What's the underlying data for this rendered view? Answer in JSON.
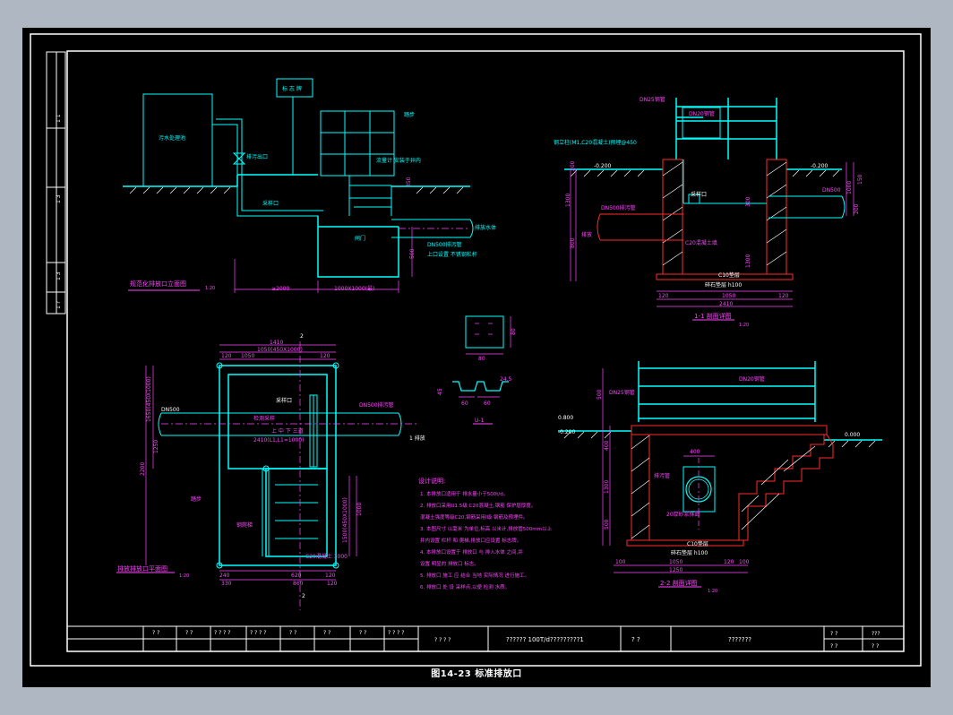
{
  "colors": {
    "background": "#000000",
    "frame": "#ffffff",
    "outline": "#00ffff",
    "dimension": "#ff44ff",
    "section": "#ff2a2a",
    "hatch": "#ffffff",
    "outer": "#aeb7c2"
  },
  "caption": "图14-23 标准排放口",
  "sidebar": {
    "labels": [
      "1 1",
      "1 3",
      "1 3",
      "1 ?"
    ]
  },
  "elevation_view": {
    "title": "规范化排放口立面图",
    "scale": "1:20",
    "sign_label": "标 志 牌",
    "outlet_label": "排污出口",
    "facility_label": "污水处理池",
    "sampling_label": "采样口",
    "ladder_label": "踏步",
    "valve_label": "闸门",
    "pipe_label": "DN500排污管",
    "pipe_dir": "排放水体",
    "min_depth": "≥2000",
    "well_size": "1000X1000(最)",
    "dim_500": "500",
    "dim_350": "350",
    "flow_note": "流量计 安装于井内",
    "wall_note": "上口设置 不锈钢栏杆"
  },
  "section_1_1": {
    "title": "1-1 剖面详图",
    "scale": "1:20",
    "elev_left": "-0.200",
    "elev_right": "-0.200",
    "rail_label": "DN25钢管",
    "rail_label2": "DN20钢管",
    "top_note": "钢立柱(M1,C20混凝土)预埋@450",
    "pipe_label": "DN500排污管",
    "pipe_label_right": "DN500",
    "hole_label": "C20混凝土填",
    "sample_label": "采样口",
    "base_label": "C10垫层",
    "base_detail": "碎石垫层 h100",
    "dims_bottom": [
      "120",
      "1050",
      "120",
      "2410"
    ],
    "dims_left": [
      "200",
      "800",
      "1300"
    ],
    "dims_right": [
      "300",
      "1300",
      "1000",
      "200",
      "150"
    ],
    "water_label": "排放"
  },
  "plan_view": {
    "title": "排放排放口平面图",
    "scale": "1:20",
    "pipe_label": "DN500",
    "pipe_right_label": "DN500排污管",
    "dir_label": "1 排放",
    "sample_label": "采样口",
    "inlet_label": "检测采样",
    "ladder_label": "钢爬梯",
    "stair_label": "踏步",
    "elev_label": "C20混凝土 3000",
    "rail_note": "上 中 下 三道",
    "rail_spec": "2410(L1,L1=1000)",
    "dims_top": [
      "1410",
      "120",
      "1050",
      "120",
      "1050(450X1000)"
    ],
    "dims_bottom": [
      "240",
      "620",
      "120",
      "330",
      "860",
      "120"
    ],
    "dims_left": [
      "1650(450X1000)",
      "1250",
      "2200"
    ],
    "dims_right": [
      "1500(450X1000)",
      "1000"
    ],
    "mark_2": "2"
  },
  "detail": {
    "label": "U-1",
    "dims": [
      "80",
      "80",
      "60",
      "60",
      "24.5",
      "45"
    ]
  },
  "notes": {
    "title": "设计说明:",
    "lines": [
      "1. 本排放口适用于 排水量小于500t/d。",
      "2. 排放口采用U1.5级 C20混凝土,钢筋 保护层厚度。",
      "   混凝土强度等级C20,钢筋采用I级 钢筋及预埋件。",
      "3. 本图尺寸 以毫米 为单位,标高 以米计,排放管500mm以上",
      "   井内设置 栏杆 和 爬梯,排放口应设置 标志牌。",
      "4. 本排放口设置于 排放口 与 排入水体 之间,并",
      "   设置 明显的 排放口 标志。",
      "5. 排放口 施工 应 结合 当地 实际情况 进行施工。",
      "6. 排放口 处 设 采样点,以便 检测 水质。"
    ]
  },
  "section_2_2": {
    "title": "2-2 剖面详图",
    "scale": "1:20",
    "rail_label": "DN20钢管",
    "rail_label2": "DN25钢管",
    "elev_left": "0.800",
    "elev_left2": "-0.200",
    "elev_right": "0.000",
    "pipe_label": "排污管",
    "fill_label": "20厚砂浆抹面",
    "base_label": "C10垫层",
    "base_detail": "碎石垫层 h100",
    "dims_bottom": [
      "100",
      "1050",
      "120",
      "1250",
      "100"
    ],
    "dims_left": [
      "500",
      "400",
      "1300",
      "500"
    ],
    "dim_top": "400"
  },
  "title_block": {
    "cells": [
      "? ?",
      "? ?",
      "? ? ? ?",
      "? ? ? ?",
      "? ?",
      "? ?",
      "? ?",
      "? ? ? ?"
    ],
    "stamp": "? ? ? ?",
    "project": "?????? 100T/d?????????1",
    "label2": "? ?",
    "drawing_name": "???????",
    "right_a": "? ?",
    "right_b": "???",
    "right_c": "? ?",
    "right_d": "? ?"
  }
}
